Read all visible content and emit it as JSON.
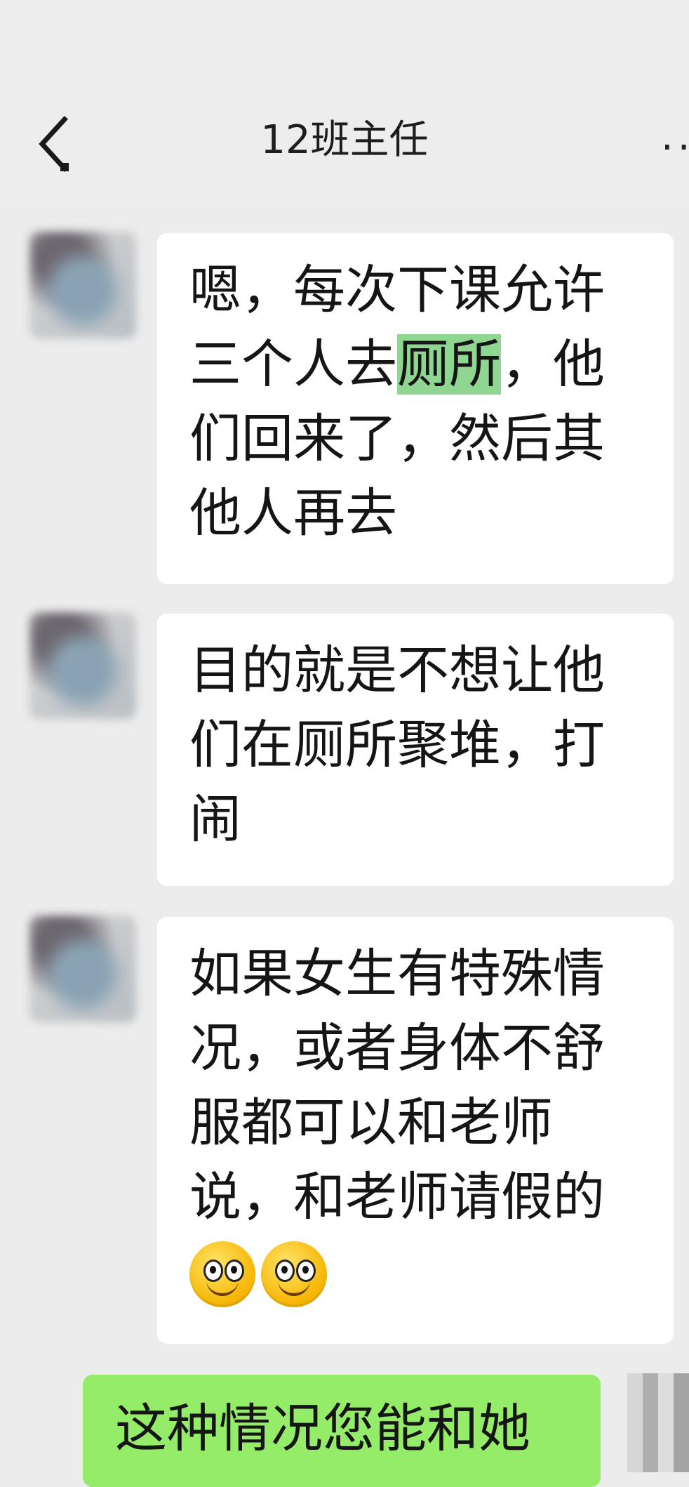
{
  "header": {
    "title": "12班主任",
    "back_icon": "chevron-left-icon",
    "more_icon": "ellipsis-icon",
    "more_glyph": "··"
  },
  "messages": [
    {
      "sender": "other",
      "text_before": "嗯，每次下课允许三个人去",
      "highlight": "厕所",
      "text_after": "，他们回来了，然后其他人再去"
    },
    {
      "sender": "other",
      "text": "目的就是不想让他们在厕所聚堆，打闹"
    },
    {
      "sender": "other",
      "text": "如果女生有特殊情况，或者身体不舒服都可以和老师说，和老师请假的",
      "emojis": [
        "smile-emoji",
        "smile-emoji"
      ]
    },
    {
      "sender": "me",
      "text": "这种情况您能和她"
    }
  ],
  "colors": {
    "background": "#ececec",
    "bubble_other": "#ffffff",
    "bubble_me": "#95ec69",
    "highlight": "#8fd693"
  }
}
